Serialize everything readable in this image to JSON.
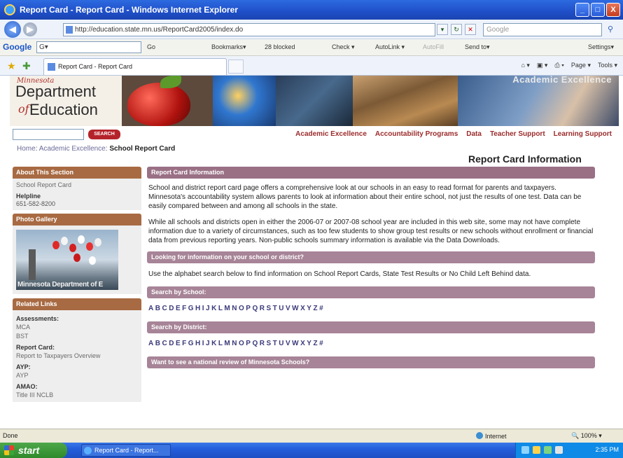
{
  "window": {
    "title": "Report Card - Report Card - Windows Internet Explorer",
    "buttons": [
      "_",
      "□",
      "X"
    ]
  },
  "address_bar": {
    "url": "http://education.state.mn.us/ReportCard2005/index.do",
    "search_placeholder": "Google"
  },
  "google_toolbar": {
    "logo": "Google",
    "search_value": "G▾",
    "items": [
      "Go",
      "Bookmarks▾",
      "28 blocked",
      "Check ▾",
      "AutoLink ▾",
      "AutoFill",
      "Send to▾",
      "Settings▾"
    ]
  },
  "tab": {
    "label": "Report Card - Report Card"
  },
  "command_bar": {
    "items": [
      "Page ▾",
      "Tools ▾"
    ]
  },
  "banner": {
    "logo_state": "Minnesota",
    "logo_department": "Department",
    "logo_of": "of",
    "logo_education": "Education",
    "tagline": "Academic Excellence"
  },
  "site_search": {
    "button": "SEARCH"
  },
  "top_nav": [
    "Academic Excellence",
    "Accountability Programs",
    "Data",
    "Teacher Support",
    "Learning Support"
  ],
  "breadcrumb": {
    "home": "Home",
    "section": "Academic Excellence",
    "current": "School Report Card"
  },
  "page_heading": "Report Card Information",
  "sidebar": {
    "about": {
      "heading": "About This Section",
      "link": "School Report Card",
      "helpline_label": "Helpline",
      "helpline_value": "651-582-8200"
    },
    "gallery": {
      "heading": "Photo Gallery",
      "caption": "Minnesota Department of E"
    },
    "related": {
      "heading": "Related Links",
      "groups": [
        {
          "label": "Assessments:",
          "links": [
            "MCA",
            "BST"
          ]
        },
        {
          "label": "Report Card:",
          "links": [
            "Report to Taxpayers Overview"
          ]
        },
        {
          "label": "AYP:",
          "links": [
            "AYP"
          ]
        },
        {
          "label": "AMAO:",
          "links": [
            "Title III NCLB"
          ]
        }
      ]
    }
  },
  "main": {
    "section1_heading": "Report Card Information",
    "paragraph1": "School and district report card page offers a comprehensive look at our schools in an easy to read format for parents and taxpayers. Minnesota's accountability system allows parents to look at information about their entire school, not just the results of one test. Data can be easily compared between and among all schools in the state.",
    "paragraph2": "While all schools and districts open in either the 2006-07 or 2007-08 school year are included in this web site, some may not have complete information due to a variety of circumstances, such as too few students to show group test results or new schools without enrollment or financial data from previous reporting years. Non-public schools summary information is available via the Data Downloads.",
    "section2_heading": "Looking for information on your school or district?",
    "paragraph3": "Use the alphabet search below to find information on School Report Cards, State Test Results or No Child Left Behind data.",
    "section3_heading": "Search by School:",
    "section4_heading": "Search by District:",
    "section5_heading": "Want to see a national review of Minnesota Schools?",
    "alphabet": [
      "A",
      "B",
      "C",
      "D",
      "E",
      "F",
      "G",
      "H",
      "I",
      "J",
      "K",
      "L",
      "M",
      "N",
      "O",
      "P",
      "Q",
      "R",
      "S",
      "T",
      "U",
      "V",
      "W",
      "X",
      "Y",
      "Z",
      "#"
    ]
  },
  "status_bar": {
    "status": "Done",
    "zone": "Internet",
    "zoom": "100%"
  },
  "taskbar": {
    "start": "start",
    "task": "Report Card - Report...",
    "clock": "2:35 PM"
  }
}
